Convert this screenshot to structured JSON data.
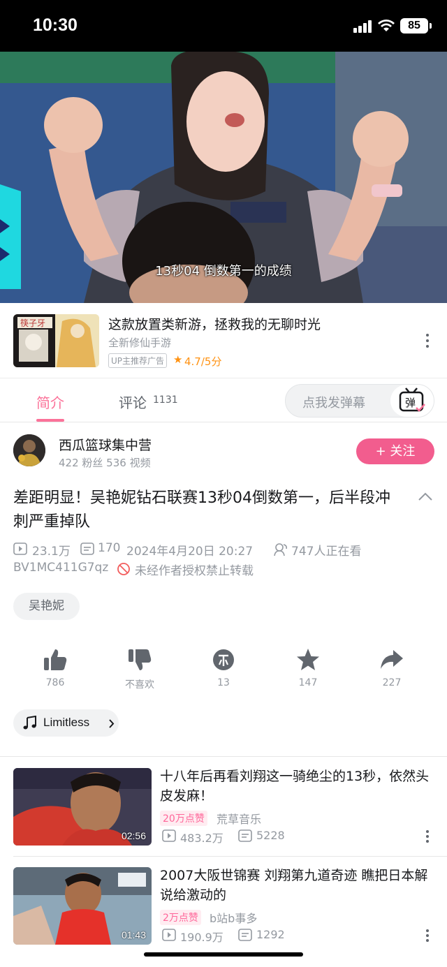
{
  "status_bar": {
    "time": "10:30",
    "battery": "85"
  },
  "video": {
    "subtitle": "13秒04 倒数第一的成绩"
  },
  "ad": {
    "title": "这款放置类新游，拯救我的无聊时光",
    "subtitle": "全新修仙手游",
    "badge": "UP主推荐广告",
    "rating": "4.7/5分",
    "thumb_text": "筷子牙"
  },
  "tabs": {
    "intro": "简介",
    "comments": "评论",
    "comments_count": "1131",
    "danmaku_placeholder": "点我发弹幕",
    "danmaku_button": "弹"
  },
  "uploader": {
    "name": "西瓜篮球集中营",
    "stats": "422 粉丝  536 视频",
    "follow_label": "+ 关注"
  },
  "video_info": {
    "title": "差距明显！吴艳妮钻石联赛13秒04倒数第一，后半段冲刺严重掉队",
    "views": "23.1万",
    "danmaku_count": "170",
    "date": "2024年4月20日 20:27",
    "watching": "747人正在看",
    "bvid": "BV1MC411G7qz",
    "copyright": "未经作者授权禁止转载"
  },
  "tags": [
    "吴艳妮"
  ],
  "actions": [
    {
      "name": "like",
      "label": "786"
    },
    {
      "name": "dislike",
      "label": "不喜欢"
    },
    {
      "name": "coin",
      "label": "13"
    },
    {
      "name": "favorite",
      "label": "147"
    },
    {
      "name": "share",
      "label": "227"
    }
  ],
  "music": {
    "title": "Limitless"
  },
  "related": [
    {
      "title": "十八年后再看刘翔这一骑绝尘的13秒，依然头皮发麻！",
      "badge": "20万点赞",
      "uploader": "荒草音乐",
      "views": "483.2万",
      "danmaku": "5228",
      "duration": "02:56"
    },
    {
      "title": "2007大阪世锦赛 刘翔第九道奇迹 瞧把日本解说给激动的",
      "badge": "2万点赞",
      "uploader": "b站b事多",
      "views": "190.9万",
      "danmaku": "1292",
      "duration": "01:43"
    }
  ],
  "colors": {
    "accent": "#fb7299",
    "follow": "#f25d8e",
    "rating": "#ff9212",
    "muted": "#9499a0"
  }
}
